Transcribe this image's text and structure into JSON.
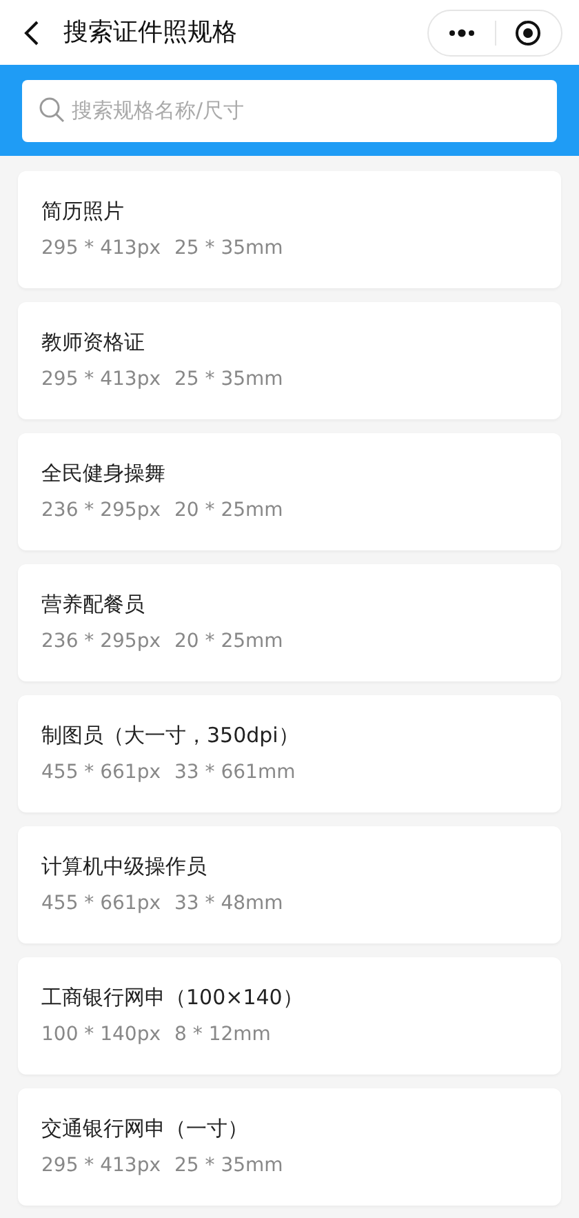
{
  "header": {
    "title": "搜索证件照规格"
  },
  "search": {
    "placeholder": "搜索规格名称/尺寸"
  },
  "specs": [
    {
      "name": "简历照片",
      "pixels": "295 * 413px",
      "size": "25 * 35mm"
    },
    {
      "name": "教师资格证",
      "pixels": "295 * 413px",
      "size": "25 * 35mm"
    },
    {
      "name": "全民健身操舞",
      "pixels": "236 * 295px",
      "size": "20 * 25mm"
    },
    {
      "name": "营养配餐员",
      "pixels": "236 * 295px",
      "size": "20 * 25mm"
    },
    {
      "name": "制图员（大一寸，350dpi）",
      "pixels": "455 * 661px",
      "size": "33 * 661mm"
    },
    {
      "name": "计算机中级操作员",
      "pixels": "455 * 661px",
      "size": "33 * 48mm"
    },
    {
      "name": "工商银行网申（100×140）",
      "pixels": "100 * 140px",
      "size": "8 * 12mm"
    },
    {
      "name": "交通银行网申（一寸）",
      "pixels": "295 * 413px",
      "size": "25 * 35mm"
    }
  ]
}
